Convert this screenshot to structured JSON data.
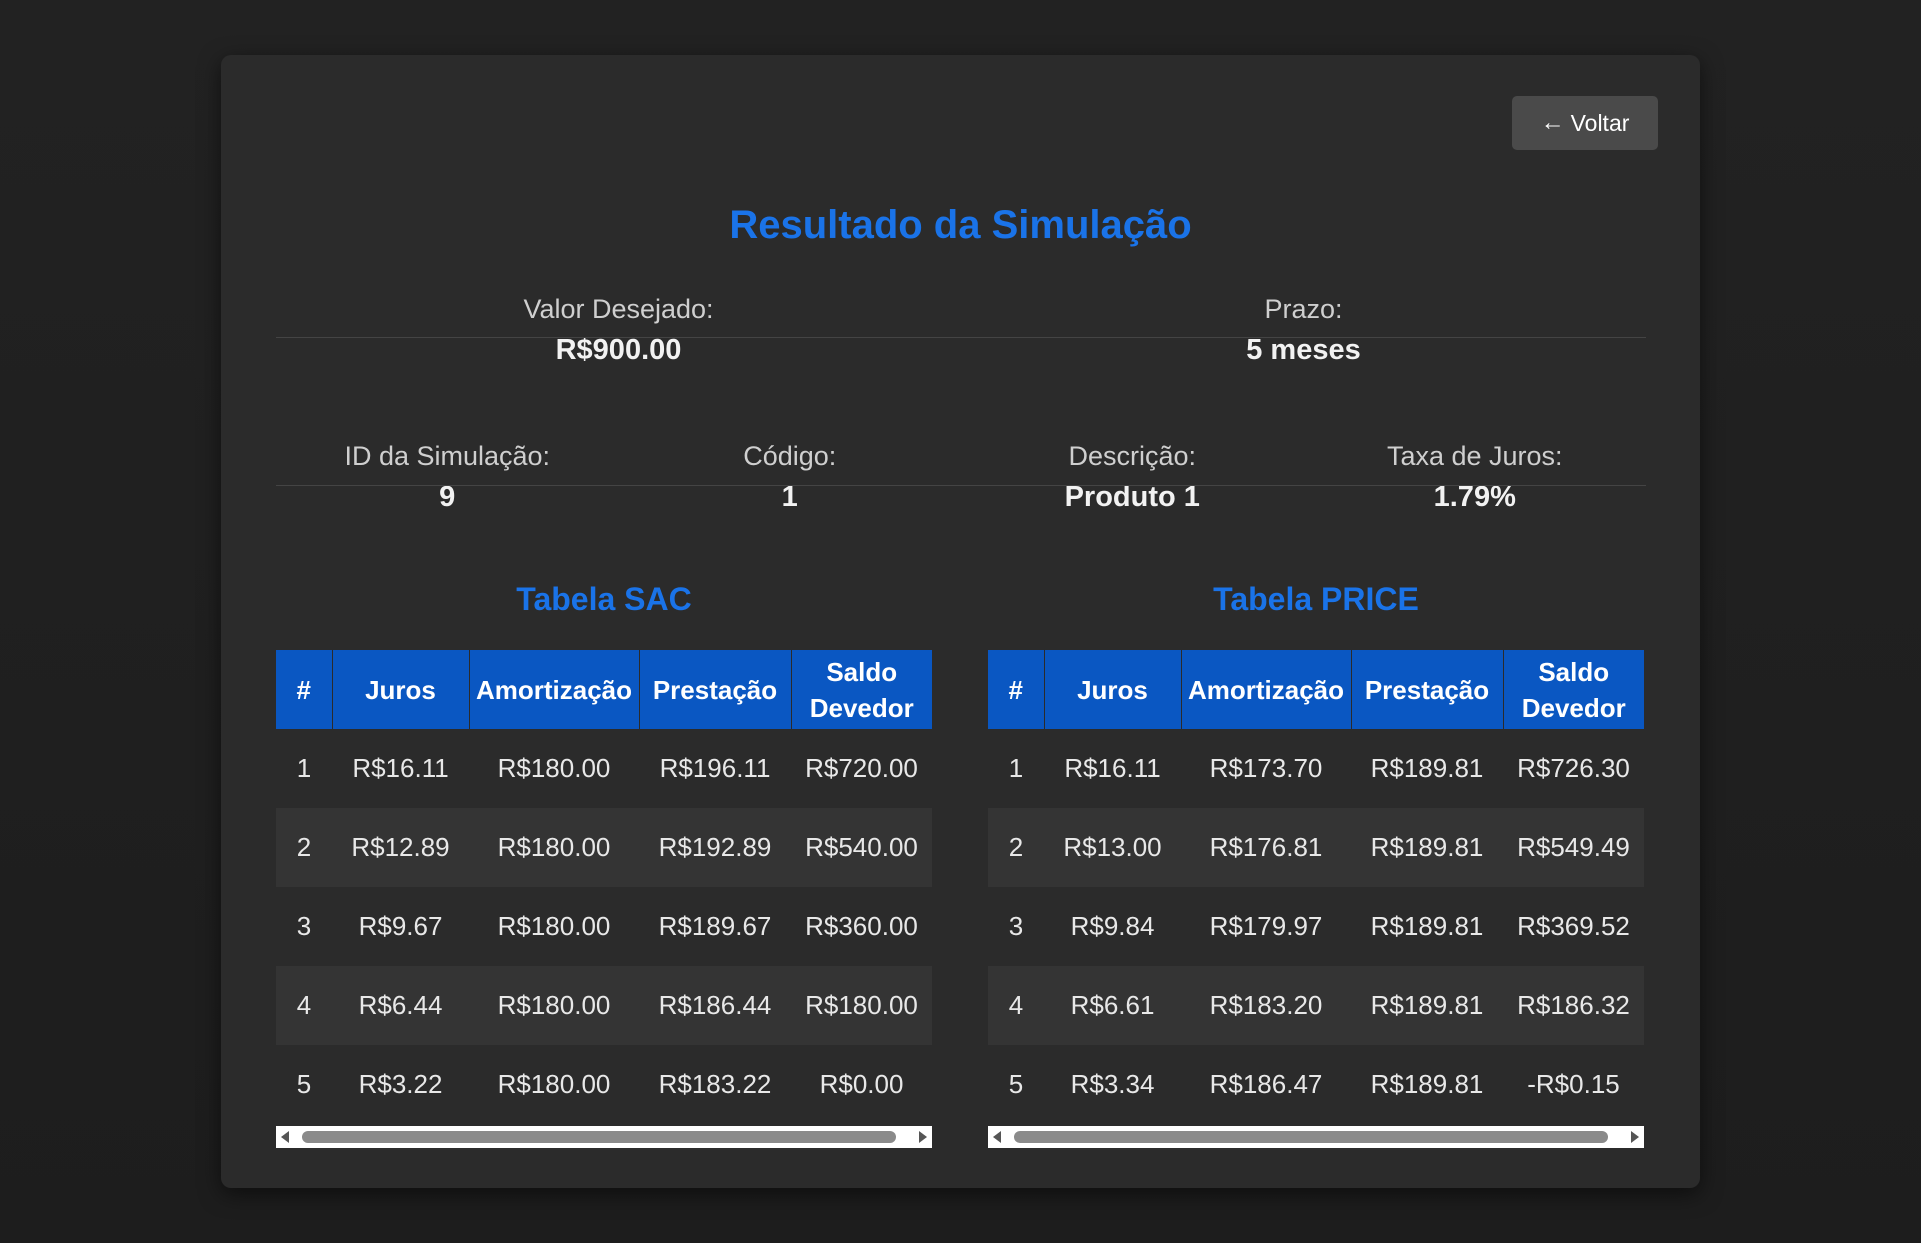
{
  "header": {
    "back_label": "Voltar",
    "back_icon": "left-arrow-icon",
    "title": "Resultado da Simulação"
  },
  "summary": {
    "valor_desejado": {
      "label": "Valor Desejado:",
      "value": "R$900.00"
    },
    "prazo": {
      "label": "Prazo:",
      "value": "5 meses"
    },
    "id_simulacao": {
      "label": "ID da Simulação:",
      "value": "9"
    },
    "codigo": {
      "label": "Código:",
      "value": "1"
    },
    "descricao": {
      "label": "Descrição:",
      "value": "Produto 1"
    },
    "taxa_juros": {
      "label": "Taxa de Juros:",
      "value": "1.79%"
    }
  },
  "tables": {
    "sac": {
      "title": "Tabela SAC",
      "columns": [
        "#",
        "Juros",
        "Amortização",
        "Prestação",
        "Saldo Devedor"
      ],
      "rows": [
        [
          "1",
          "R$16.11",
          "R$180.00",
          "R$196.11",
          "R$720.00"
        ],
        [
          "2",
          "R$12.89",
          "R$180.00",
          "R$192.89",
          "R$540.00"
        ],
        [
          "3",
          "R$9.67",
          "R$180.00",
          "R$189.67",
          "R$360.00"
        ],
        [
          "4",
          "R$6.44",
          "R$180.00",
          "R$186.44",
          "R$180.00"
        ],
        [
          "5",
          "R$3.22",
          "R$180.00",
          "R$183.22",
          "R$0.00"
        ]
      ]
    },
    "price": {
      "title": "Tabela PRICE",
      "columns": [
        "#",
        "Juros",
        "Amortização",
        "Prestação",
        "Saldo Devedor"
      ],
      "rows": [
        [
          "1",
          "R$16.11",
          "R$173.70",
          "R$189.81",
          "R$726.30"
        ],
        [
          "2",
          "R$13.00",
          "R$176.81",
          "R$189.81",
          "R$549.49"
        ],
        [
          "3",
          "R$9.84",
          "R$179.97",
          "R$189.81",
          "R$369.52"
        ],
        [
          "4",
          "R$6.61",
          "R$183.20",
          "R$189.81",
          "R$186.32"
        ],
        [
          "5",
          "R$3.34",
          "R$186.47",
          "R$189.81",
          "-R$0.15"
        ]
      ]
    }
  },
  "colors": {
    "accent": "#1a73e8",
    "table_header": "#0a57c2",
    "card_bg": "#2b2b2b",
    "page_bg": "#222222",
    "button_bg": "#4a4a4a"
  }
}
